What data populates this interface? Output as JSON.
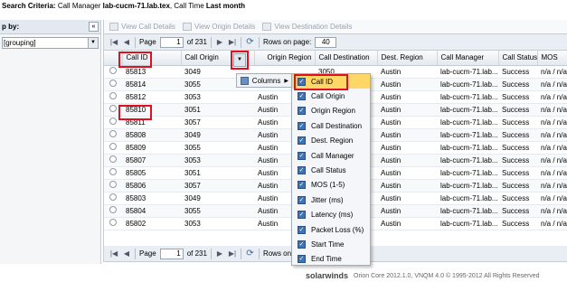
{
  "criteria": {
    "label": "Search Criteria:",
    "prefix": "Call Manager",
    "manager": "lab-cucm-71.lab.tex",
    "sep": ", Call Time",
    "time": "Last month"
  },
  "left_panel": {
    "group_by_label": "p by:",
    "collapse_glyph": "«",
    "group_select_value": "[grouping]"
  },
  "toolbar": {
    "view_call_details": "View Call Details",
    "view_origin_details": "View Origin Details",
    "view_destination_details": "View Destination Details"
  },
  "pager": {
    "page_label": "Page",
    "page_value": "1",
    "of_label": "of 231",
    "rows_label": "Rows on page:",
    "rows_value": "40"
  },
  "pager_bottom": {
    "page_label": "Page",
    "page_value": "1",
    "of_label": "of 231",
    "rows_label": "Rows on pa"
  },
  "columns": [
    "Call ID",
    "Call Origin",
    "Origin Region",
    "Call Destination",
    "Dest. Region",
    "Call Manager",
    "Call Status",
    "MOS"
  ],
  "rows": [
    [
      "85813",
      "3049",
      "",
      "3050",
      "Austin",
      "lab-cucm-71.lab...",
      "Success",
      "n/a / n/a"
    ],
    [
      "85814",
      "3055",
      "",
      "",
      "Austin",
      "lab-cucm-71.lab...",
      "Success",
      "n/a / n/a"
    ],
    [
      "85812",
      "3053",
      "Austin",
      "",
      "Austin",
      "lab-cucm-71.lab...",
      "Success",
      "n/a / n/a"
    ],
    [
      "85810",
      "3051",
      "Austin",
      "",
      "Austin",
      "lab-cucm-71.lab...",
      "Success",
      "n/a / n/a"
    ],
    [
      "85811",
      "3057",
      "Austin",
      "",
      "Austin",
      "lab-cucm-71.lab...",
      "Success",
      "n/a / n/a"
    ],
    [
      "85808",
      "3049",
      "Austin",
      "",
      "Austin",
      "lab-cucm-71.lab...",
      "Success",
      "n/a / n/a"
    ],
    [
      "85809",
      "3055",
      "Austin",
      "",
      "Austin",
      "lab-cucm-71.lab...",
      "Success",
      "n/a / n/a"
    ],
    [
      "85807",
      "3053",
      "Austin",
      "",
      "Austin",
      "lab-cucm-71.lab...",
      "Success",
      "n/a / n/a"
    ],
    [
      "85805",
      "3051",
      "Austin",
      "",
      "Austin",
      "lab-cucm-71.lab...",
      "Success",
      "n/a / n/a"
    ],
    [
      "85806",
      "3057",
      "Austin",
      "",
      "Austin",
      "lab-cucm-71.lab...",
      "Success",
      "n/a / n/a"
    ],
    [
      "85803",
      "3049",
      "Austin",
      "",
      "Austin",
      "lab-cucm-71.lab...",
      "Success",
      "n/a / n/a"
    ],
    [
      "85804",
      "3055",
      "Austin",
      "",
      "Austin",
      "lab-cucm-71.lab...",
      "Success",
      "n/a / n/a"
    ],
    [
      "85802",
      "3053",
      "Austin",
      "",
      "Austin",
      "lab-cucm-71.lab...",
      "Success",
      "n/a / n/a"
    ]
  ],
  "columns_menu": {
    "label": "Columns",
    "items": [
      "Call ID",
      "Call Origin",
      "Origin Region",
      "Call Destination",
      "Dest. Region",
      "Call Manager",
      "Call Status",
      "MOS (1-5)",
      "Jitter (ms)",
      "Latency (ms)",
      "Packet Loss (%)",
      "Start Time",
      "End Time"
    ]
  },
  "footer": {
    "brand": "solarwinds",
    "text": "Orion Core 2012.1.0, VNQM 4.0 © 1995-2012 All Rights Reserved"
  },
  "colors": {
    "highlight_red": "#e01020",
    "menu_highlight": "#ffd766",
    "checkbox_blue": "#3d74b5"
  }
}
